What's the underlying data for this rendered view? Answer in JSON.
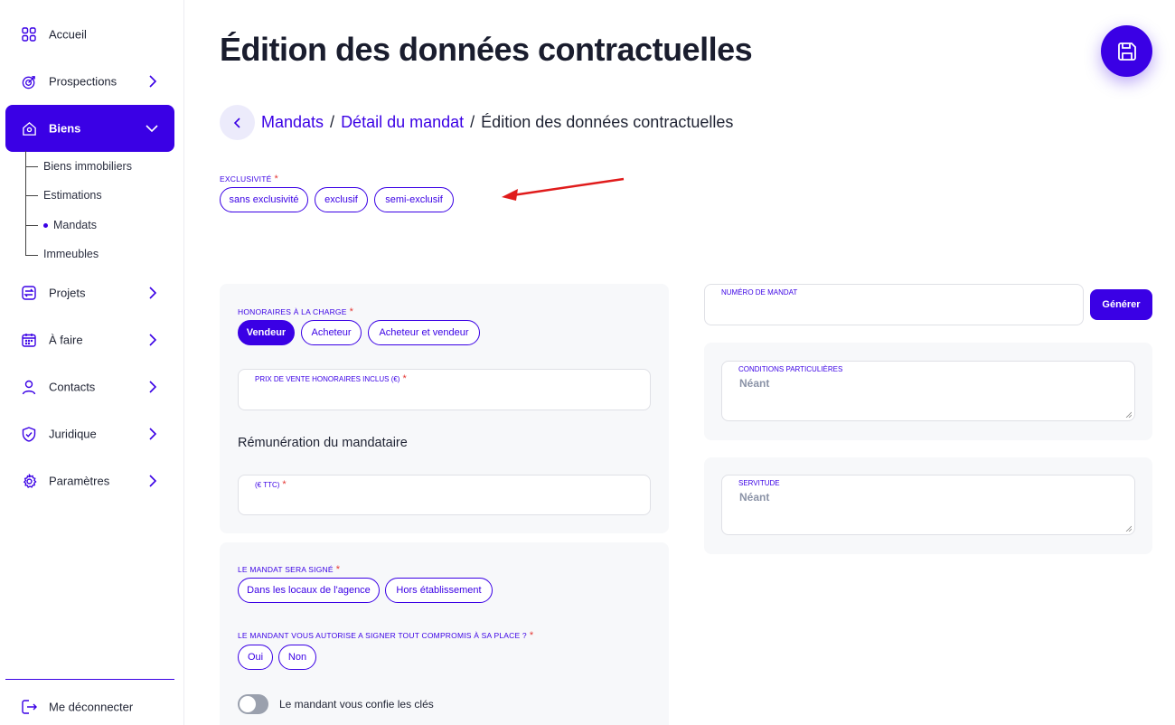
{
  "sidebar": {
    "items": [
      {
        "label": "Accueil",
        "icon": "grid-icon"
      },
      {
        "label": "Prospections",
        "icon": "target-icon"
      },
      {
        "label": "Biens",
        "icon": "house-icon"
      },
      {
        "label": "Projets",
        "icon": "swap-icon"
      },
      {
        "label": "À faire",
        "icon": "calendar-icon"
      },
      {
        "label": "Contacts",
        "icon": "user-icon"
      },
      {
        "label": "Juridique",
        "icon": "shield-icon"
      },
      {
        "label": "Paramètres",
        "icon": "gear-icon"
      }
    ],
    "sub_items": [
      "Biens immobiliers",
      "Estimations",
      "Mandats",
      "Immeubles"
    ],
    "active_sub": "Mandats",
    "logout_label": "Me déconnecter"
  },
  "page": {
    "title": "Édition des données contractuelles",
    "breadcrumb": {
      "link1": "Mandats",
      "link2": "Détail du mandat",
      "separator": "/",
      "current": "Édition des données contractuelles"
    }
  },
  "exclusivite": {
    "label": "EXCLUSIVITÉ",
    "required_mark": "*",
    "options": [
      "sans exclusivité",
      "exclusif",
      "semi-exclusif"
    ]
  },
  "honoraires": {
    "label": "HONORAIRES À LA CHARGE",
    "options": [
      "Vendeur",
      "Acheteur",
      "Acheteur et vendeur"
    ],
    "selected": "Vendeur"
  },
  "prix_vente": {
    "label": "PRIX DE VENTE HONORAIRES INCLUS (€)",
    "value": ""
  },
  "remuneration": {
    "heading": "Rémunération du mandataire",
    "field_label": "(€ TTC)",
    "value": ""
  },
  "signature": {
    "label": "LE MANDAT SERA SIGNÉ",
    "options": [
      "Dans les locaux de l'agence",
      "Hors établissement"
    ]
  },
  "autorisation": {
    "label": "LE MANDANT VOUS AUTORISE A SIGNER TOUT COMPROMIS À SA PLACE ?",
    "options": [
      "Oui",
      "Non"
    ]
  },
  "cles": {
    "label": "Le mandant vous confie les clés",
    "enabled": false
  },
  "numero_mandat": {
    "label": "NUMÉRO DE MANDAT",
    "value": "",
    "button_label": "Générer"
  },
  "conditions": {
    "label": "CONDITIONS PARTICULIÈRES",
    "placeholder": "Néant"
  },
  "servitude": {
    "label": "SERVITUDE",
    "placeholder": "Néant"
  },
  "colors": {
    "accent": "#3a00e5",
    "required": "#e53935",
    "annotation_arrow": "#e01b1b"
  }
}
